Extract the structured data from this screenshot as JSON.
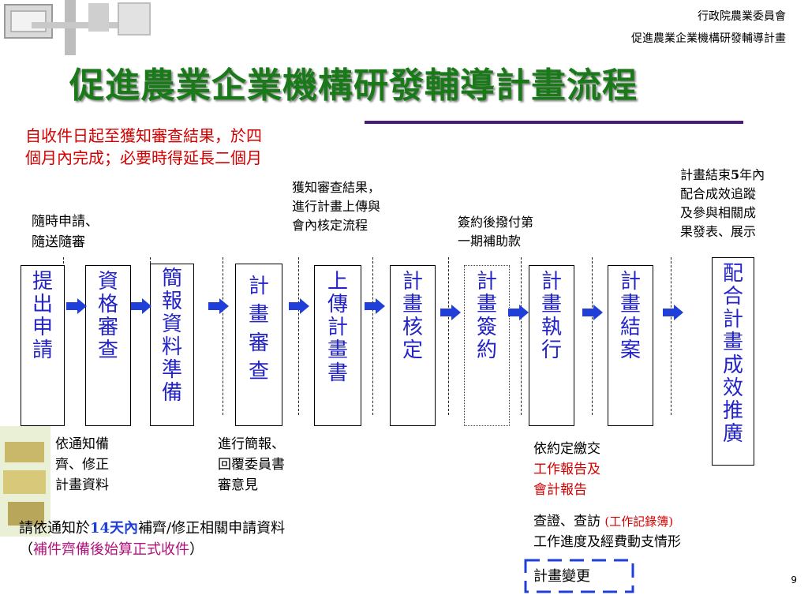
{
  "header": {
    "org_line1": "行政院農業委員會",
    "org_line2": "促進農業企業機構研發輔導計畫",
    "title": "促進農業企業機構研發輔導計畫流程"
  },
  "note": {
    "line1": "自收件日起至獲知審查結果，於四",
    "line2": "個月內完成；必要時得延長二個月"
  },
  "steps": [
    {
      "label": "提出申請"
    },
    {
      "label": "資格審查"
    },
    {
      "label": "簡報資料準備"
    },
    {
      "label": "計畫審查"
    },
    {
      "label": "上傳計畫書"
    },
    {
      "label": "計畫核定"
    },
    {
      "label": "計畫簽約"
    },
    {
      "label": "計畫執行"
    },
    {
      "label": "計畫結案"
    },
    {
      "label": "配合計畫成效推廣"
    }
  ],
  "annotations": {
    "apply": {
      "line1": "隨時申請、",
      "line2": "隨送隨審"
    },
    "review_result": {
      "line1": "獲知審查結果，",
      "line2": "進行計畫上傳與",
      "line3": "會內核定流程"
    },
    "payment": {
      "line1": "簽約後撥付第",
      "line2": "一期補助款"
    },
    "followup": {
      "line1a": "計畫結束",
      "line1b": "5",
      "line1c": "年內",
      "line2": "配合成效追蹤",
      "line3": "及參與相關成",
      "line4": "果發表、展示"
    },
    "supplement": {
      "line1": "依通知備",
      "line2": "齊、修正",
      "line3": "計畫資料"
    },
    "briefing": {
      "line1": "進行簡報、",
      "line2": "回覆委員書",
      "line3": "審意見"
    },
    "report": {
      "line1": "依約定繳交",
      "line2": "工作報告及",
      "line3": "會計報告"
    },
    "audit": {
      "line1a": "查證、查訪 ",
      "line1b": "(工作記錄簿)",
      "line2": "工作進度及經費動支情形"
    }
  },
  "footnote": {
    "p1": "請依通知於",
    "p2": "14天內",
    "p3": "補齊/修正相關申請資料",
    "p4": "（",
    "p5": "補件齊備後始算正式收件",
    "p6": "）"
  },
  "change_label": "計畫變更",
  "page_number": "9",
  "colors": {
    "title": "#1a7a1a",
    "box_text": "#2323c8",
    "arrow": "#1f3fd8",
    "accent_red": "#d40000",
    "rule": "#4b1a7a"
  }
}
